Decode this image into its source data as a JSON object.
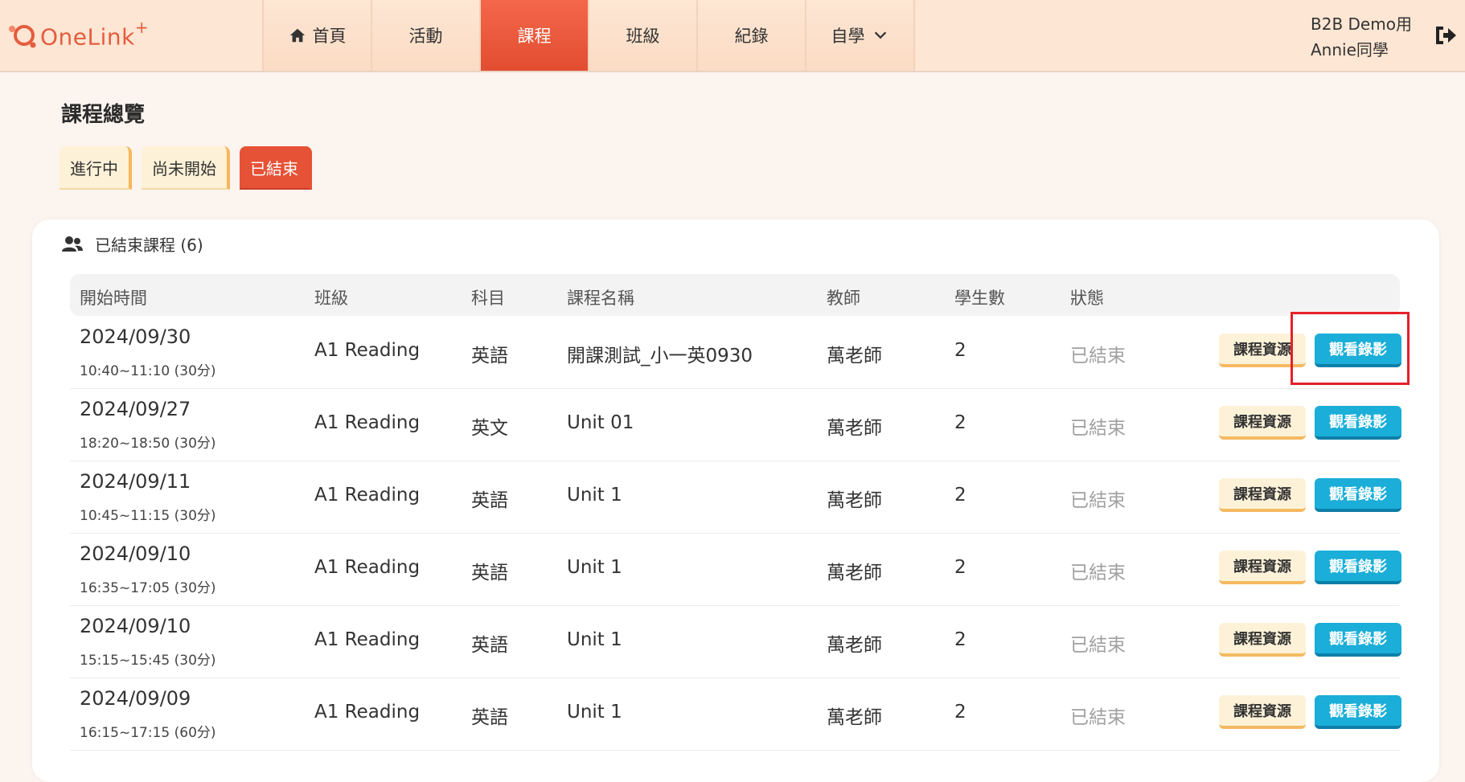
{
  "app": {
    "logo_text": "OneLink",
    "logo_plus": "+",
    "brand_color": "#e45d3f",
    "accent_color": "#e24d31"
  },
  "nav": {
    "items": [
      {
        "label": "首頁",
        "icon": "home-icon",
        "active": false
      },
      {
        "label": "活動",
        "active": false
      },
      {
        "label": "課程",
        "active": true
      },
      {
        "label": "班級",
        "active": false
      },
      {
        "label": "紀錄",
        "active": false
      },
      {
        "label": "自學",
        "icon": "chevron-down-icon",
        "active": false
      }
    ]
  },
  "user": {
    "org": "B2B Demo用",
    "name": "Annie同學",
    "logout_icon": "logout-icon"
  },
  "page": {
    "title": "課程總覽"
  },
  "tabs": [
    {
      "label": "進行中",
      "active": false
    },
    {
      "label": "尚未開始",
      "active": false
    },
    {
      "label": "已結束",
      "active": true
    }
  ],
  "card": {
    "icon": "users-icon",
    "title": "已結束課程 (6)",
    "columns": [
      "開始時間",
      "班級",
      "科目",
      "課程名稱",
      "教師",
      "學生數",
      "狀態"
    ],
    "rows": [
      {
        "date": "2024/09/30",
        "time": "10:40~11:10 (30分)",
        "class": "A1 Reading",
        "subject": "英語",
        "course": "開課測試_小一英0930",
        "teacher": "萬老師",
        "students": "2",
        "status": "已結束",
        "btn_resources": "課程資源",
        "btn_recording": "觀看錄影"
      },
      {
        "date": "2024/09/27",
        "time": "18:20~18:50 (30分)",
        "class": "A1 Reading",
        "subject": "英文",
        "course": "Unit 01",
        "teacher": "萬老師",
        "students": "2",
        "status": "已結束",
        "btn_resources": "課程資源",
        "btn_recording": "觀看錄影"
      },
      {
        "date": "2024/09/11",
        "time": "10:45~11:15 (30分)",
        "class": "A1 Reading",
        "subject": "英語",
        "course": "Unit 1",
        "teacher": "萬老師",
        "students": "2",
        "status": "已結束",
        "btn_resources": "課程資源",
        "btn_recording": "觀看錄影"
      },
      {
        "date": "2024/09/10",
        "time": "16:35~17:05 (30分)",
        "class": "A1 Reading",
        "subject": "英語",
        "course": "Unit 1",
        "teacher": "萬老師",
        "students": "2",
        "status": "已結束",
        "btn_resources": "課程資源",
        "btn_recording": "觀看錄影"
      },
      {
        "date": "2024/09/10",
        "time": "15:15~15:45 (30分)",
        "class": "A1 Reading",
        "subject": "英語",
        "course": "Unit 1",
        "teacher": "萬老師",
        "students": "2",
        "status": "已結束",
        "btn_resources": "課程資源",
        "btn_recording": "觀看錄影"
      },
      {
        "date": "2024/09/09",
        "time": "16:15~17:15 (60分)",
        "class": "A1 Reading",
        "subject": "英語",
        "course": "Unit 1",
        "teacher": "萬老師",
        "students": "2",
        "status": "已結束",
        "btn_resources": "課程資源",
        "btn_recording": "觀看錄影"
      }
    ]
  }
}
